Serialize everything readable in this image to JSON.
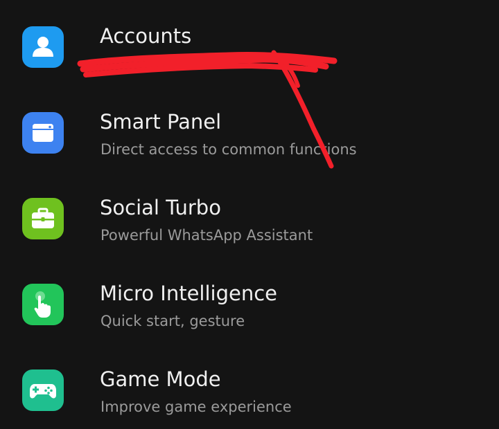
{
  "settings": {
    "items": [
      {
        "title": "Accounts",
        "subtitle": "",
        "icon": "account-icon",
        "icon_color": "#1e9bf0"
      },
      {
        "title": "Smart Panel",
        "subtitle": "Direct access to common functions",
        "icon": "smart-panel-icon",
        "icon_color": "#3d82f0"
      },
      {
        "title": "Social Turbo",
        "subtitle": "Powerful WhatsApp Assistant",
        "icon": "briefcase-icon",
        "icon_color": "#6fc11f"
      },
      {
        "title": "Micro Intelligence",
        "subtitle": "Quick start, gesture",
        "icon": "hand-gesture-icon",
        "icon_color": "#22c55a"
      },
      {
        "title": "Game Mode",
        "subtitle": "Improve game experience",
        "icon": "gamepad-icon",
        "icon_color": "#1fbf8f"
      }
    ]
  },
  "annotation": {
    "color": "#f2202a"
  }
}
